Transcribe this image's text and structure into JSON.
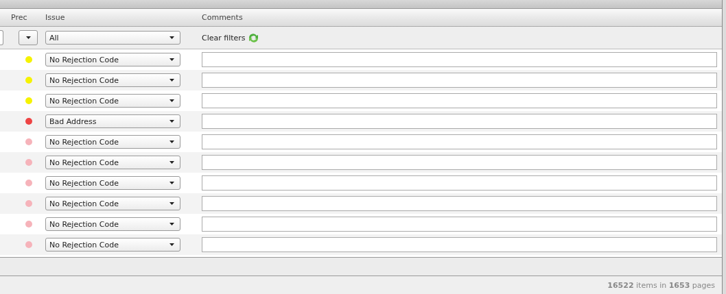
{
  "columns": [
    "Prec",
    "Issue",
    "Comments"
  ],
  "filters": {
    "issue": "All",
    "clear_label": "Clear filters"
  },
  "rows": [
    {
      "color": "#f5f200",
      "issue": "No Rejection Code"
    },
    {
      "color": "#f5f200",
      "issue": "No Rejection Code"
    },
    {
      "color": "#f5f200",
      "issue": "No Rejection Code"
    },
    {
      "color": "#ee4444",
      "issue": "Bad Address"
    },
    {
      "color": "#f6b3ba",
      "issue": "No Rejection Code"
    },
    {
      "color": "#f6b3ba",
      "issue": "No Rejection Code"
    },
    {
      "color": "#f6b3ba",
      "issue": "No Rejection Code"
    },
    {
      "color": "#f6b3ba",
      "issue": "No Rejection Code"
    },
    {
      "color": "#f6b3ba",
      "issue": "No Rejection Code"
    },
    {
      "color": "#f6b3ba",
      "issue": "No Rejection Code"
    }
  ],
  "status_bar": "**16522** items in **1653** pages"
}
